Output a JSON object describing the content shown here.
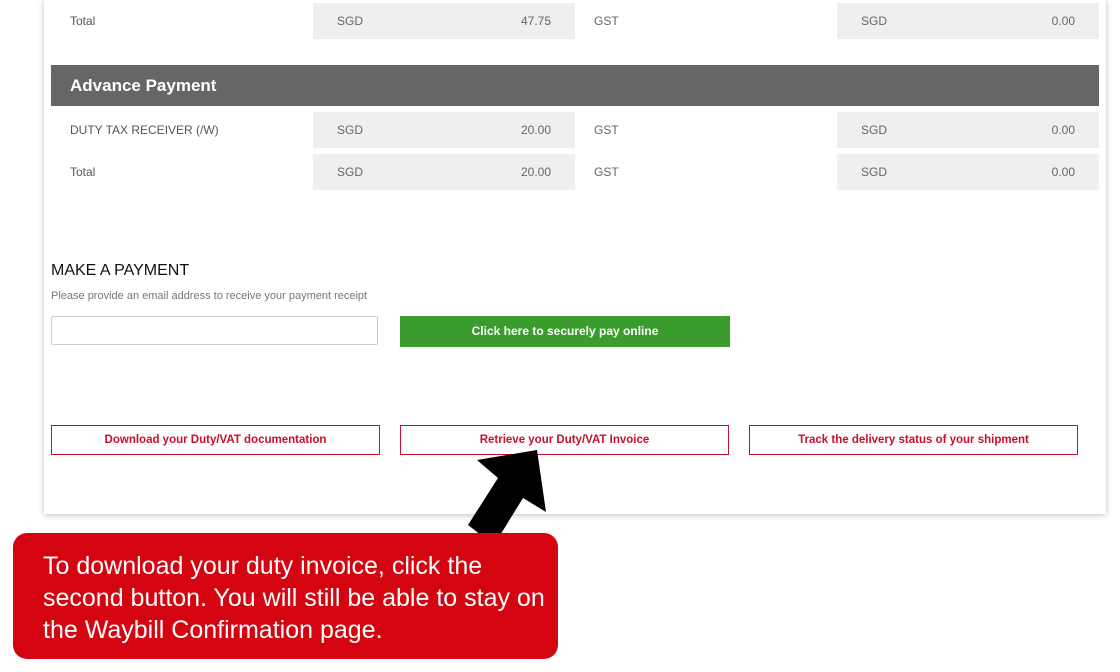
{
  "summary_rows": [
    {
      "label": "Total",
      "currency": "SGD",
      "amount": "47.75",
      "gst_label": "GST",
      "gst_currency": "SGD",
      "gst_amount": "0.00"
    }
  ],
  "advance_payment": {
    "title": "Advance Payment",
    "rows": [
      {
        "label": "DUTY TAX RECEIVER (/W)",
        "currency": "SGD",
        "amount": "20.00",
        "gst_label": "GST",
        "gst_currency": "SGD",
        "gst_amount": "0.00"
      },
      {
        "label": "Total",
        "currency": "SGD",
        "amount": "20.00",
        "gst_label": "GST",
        "gst_currency": "SGD",
        "gst_amount": "0.00"
      }
    ]
  },
  "payment": {
    "title": "MAKE A PAYMENT",
    "hint": "Please provide an email address to receive your payment receipt",
    "email_value": "",
    "pay_button": "Click here to securely pay online"
  },
  "actions": {
    "download": "Download your Duty/VAT documentation",
    "retrieve": "Retrieve your Duty/VAT Invoice",
    "track": "Track the delivery status of your shipment"
  },
  "callout": {
    "text": "To download your duty invoice, click the second button. You will still be able to stay on the Waybill Confirmation page."
  },
  "colors": {
    "header_bg": "#666666",
    "pay_green": "#3a9c2c",
    "brand_red": "#d40511",
    "outline_red": "#c8102e"
  },
  "icons": {
    "pointer": "black-arrow-pointer"
  }
}
